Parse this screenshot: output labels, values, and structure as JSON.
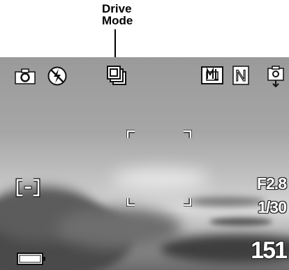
{
  "callout": {
    "label": "Drive\nMode"
  },
  "viewfinder": {
    "icons": {
      "shooting_mode": "camera-icon",
      "flash": "flash-off-icon",
      "drive_mode": "continuous-drive-icon",
      "metering": "metering-icon",
      "compression": "N",
      "af_lock": "af-lock-icon",
      "focus_area": "spot-focus-icon",
      "battery": "battery-icon"
    },
    "aperture": "F2.8",
    "shutter_speed": "1/30",
    "shots_remaining": "151"
  }
}
